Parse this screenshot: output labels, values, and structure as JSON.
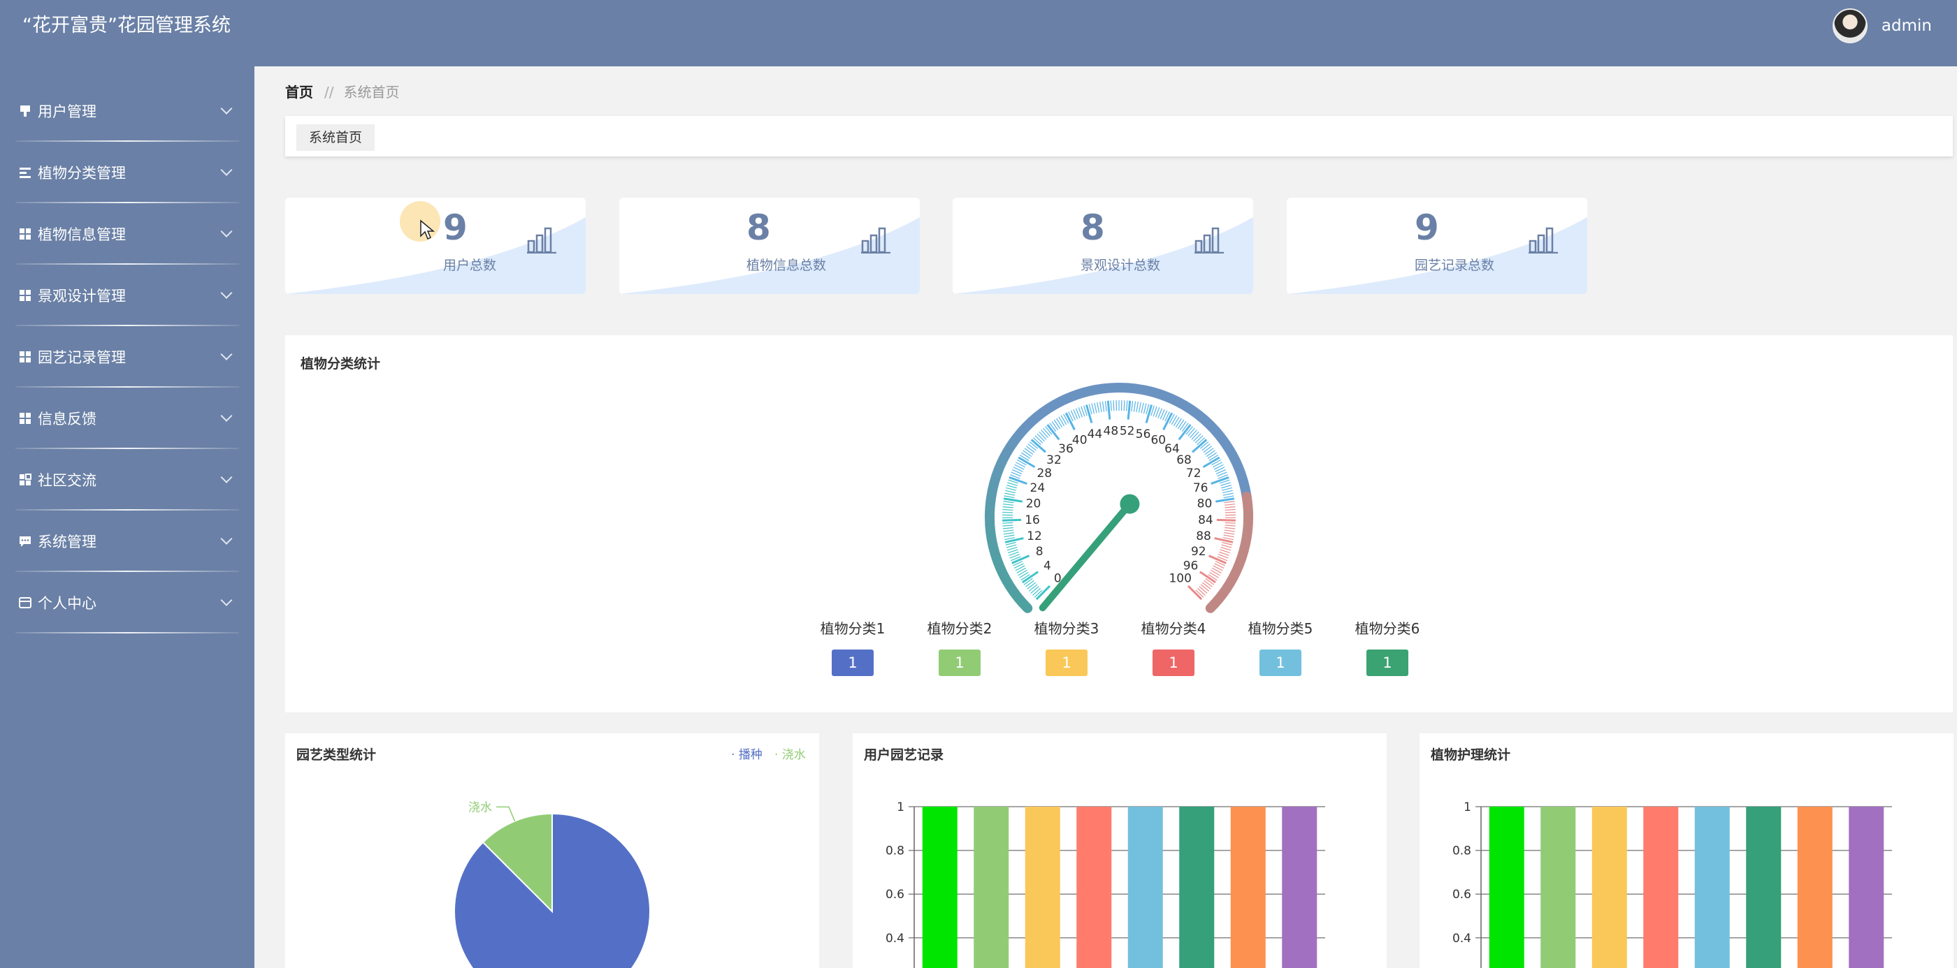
{
  "app": {
    "title": "“花开富贵”花园管理系统"
  },
  "user": {
    "name": "admin"
  },
  "sidebar": {
    "items": [
      {
        "label": "用户管理",
        "icon": "pin-icon"
      },
      {
        "label": "植物分类管理",
        "icon": "list-icon"
      },
      {
        "label": "植物信息管理",
        "icon": "grid-icon"
      },
      {
        "label": "景观设计管理",
        "icon": "grid-icon"
      },
      {
        "label": "园艺记录管理",
        "icon": "grid-icon"
      },
      {
        "label": "信息反馈",
        "icon": "grid-icon"
      },
      {
        "label": "社区交流",
        "icon": "apps-icon"
      },
      {
        "label": "系统管理",
        "icon": "chat-icon"
      },
      {
        "label": "个人中心",
        "icon": "card-icon"
      }
    ]
  },
  "breadcrumb": {
    "home": "首页",
    "separator": "//",
    "current": "系统首页"
  },
  "tabs": [
    {
      "label": "系统首页"
    }
  ],
  "stats": [
    {
      "value": "9",
      "label": "用户总数"
    },
    {
      "value": "8",
      "label": "植物信息总数"
    },
    {
      "value": "8",
      "label": "景观设计总数"
    },
    {
      "value": "9",
      "label": "园艺记录总数"
    }
  ],
  "colors": {
    "primary": "#6a80a6",
    "palette": [
      "#5470c6",
      "#91cc75",
      "#fac858",
      "#ee6666",
      "#73c0de",
      "#3ba272"
    ],
    "bars": [
      "#00e500",
      "#91cc75",
      "#fac858",
      "#ff7b6b",
      "#73c0de",
      "#35a07a",
      "#fc9150",
      "#a270c0"
    ]
  },
  "gauge_panel": {
    "title": "植物分类统计",
    "ticks": [
      "0",
      "4",
      "8",
      "12",
      "16",
      "20",
      "24",
      "28",
      "32",
      "36",
      "40",
      "44",
      "48",
      "52",
      "56",
      "60",
      "64",
      "68",
      "72",
      "76",
      "80",
      "84",
      "88",
      "92",
      "96",
      "100"
    ],
    "categories": [
      {
        "label": "植物分类1",
        "value": "1"
      },
      {
        "label": "植物分类2",
        "value": "1"
      },
      {
        "label": "植物分类3",
        "value": "1"
      },
      {
        "label": "植物分类4",
        "value": "1"
      },
      {
        "label": "植物分类5",
        "value": "1"
      },
      {
        "label": "植物分类6",
        "value": "1"
      }
    ]
  },
  "chart_data": [
    {
      "type": "pie",
      "title": "园艺类型统计",
      "legend": [
        "播种",
        "浇水"
      ],
      "legend_position": "top-right",
      "slices": [
        {
          "name": "播种",
          "value": 7
        },
        {
          "name": "浇水",
          "value": 1
        }
      ],
      "labels_shown": [
        "浇水"
      ]
    },
    {
      "type": "bar",
      "title": "用户园艺记录",
      "values": [
        1,
        1,
        1,
        1,
        1,
        1,
        1,
        1
      ],
      "ylim": [
        0,
        1
      ],
      "yticks": [
        "1",
        "0.8",
        "0.6",
        "0.4"
      ],
      "grid": true
    },
    {
      "type": "bar",
      "title": "植物护理统计",
      "values": [
        1,
        1,
        1,
        1,
        1,
        1,
        1,
        1
      ],
      "ylim": [
        0,
        1
      ],
      "yticks": [
        "1",
        "0.8",
        "0.6",
        "0.4"
      ],
      "grid": true
    }
  ]
}
